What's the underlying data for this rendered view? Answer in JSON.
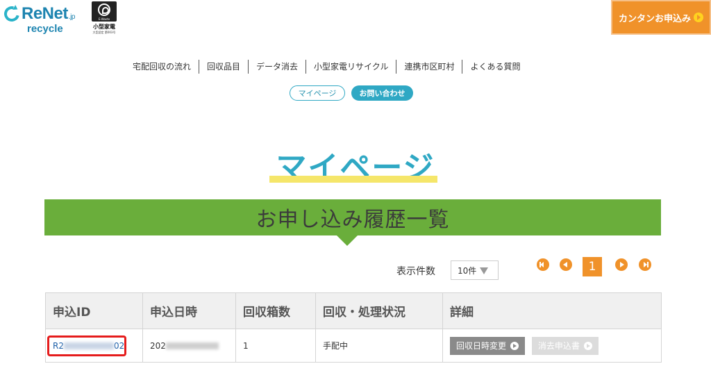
{
  "header": {
    "logo_brand": "ReNet",
    "logo_tld": ".jp",
    "logo_sub": "recycle",
    "badge_label": "小型家電",
    "badge_note": "大臣認定 第003号",
    "badge_tile_text": "E-Waste",
    "cta_label": "カンタンお申込み"
  },
  "nav": {
    "items": [
      "宅配回収の流れ",
      "回収品目",
      "データ消去",
      "小型家電リサイクル",
      "連携市区町村",
      "よくある質問"
    ],
    "mypage_label": "マイページ",
    "contact_label": "お問い合わせ"
  },
  "main": {
    "page_title": "マイページ",
    "banner_title": "お申し込み履歴一覧",
    "count_label": "表示件数",
    "count_value": "10件",
    "current_page": "1"
  },
  "table": {
    "headers": [
      "申込ID",
      "申込日時",
      "回収箱数",
      "回収・処理状況",
      "詳細"
    ],
    "rows": [
      {
        "id_prefix": "R2",
        "id_suffix": "02",
        "date_prefix": "202",
        "boxes": "1",
        "status": "手配中",
        "change_date_label": "回収日時変更",
        "cancel_label": "消去申込書"
      }
    ]
  },
  "colors": {
    "accent_blue": "#2fa8c4",
    "accent_orange": "#f0922a",
    "banner_green": "#6aae3b",
    "highlight_red": "#e51c1c"
  }
}
